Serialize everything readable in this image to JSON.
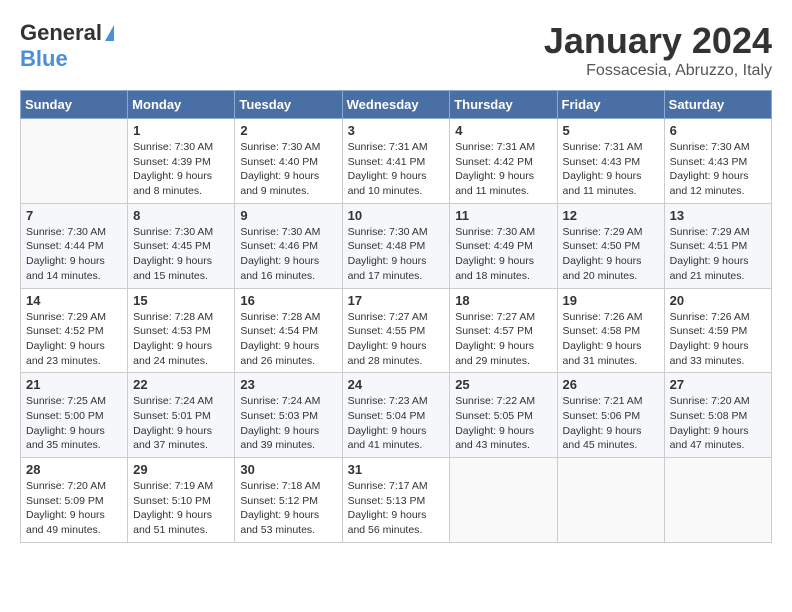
{
  "logo": {
    "general": "General",
    "blue": "Blue"
  },
  "title": "January 2024",
  "location": "Fossacesia, Abruzzo, Italy",
  "weekdays": [
    "Sunday",
    "Monday",
    "Tuesday",
    "Wednesday",
    "Thursday",
    "Friday",
    "Saturday"
  ],
  "weeks": [
    [
      {
        "day": "",
        "info": ""
      },
      {
        "day": "1",
        "info": "Sunrise: 7:30 AM\nSunset: 4:39 PM\nDaylight: 9 hours\nand 8 minutes."
      },
      {
        "day": "2",
        "info": "Sunrise: 7:30 AM\nSunset: 4:40 PM\nDaylight: 9 hours\nand 9 minutes."
      },
      {
        "day": "3",
        "info": "Sunrise: 7:31 AM\nSunset: 4:41 PM\nDaylight: 9 hours\nand 10 minutes."
      },
      {
        "day": "4",
        "info": "Sunrise: 7:31 AM\nSunset: 4:42 PM\nDaylight: 9 hours\nand 11 minutes."
      },
      {
        "day": "5",
        "info": "Sunrise: 7:31 AM\nSunset: 4:43 PM\nDaylight: 9 hours\nand 11 minutes."
      },
      {
        "day": "6",
        "info": "Sunrise: 7:30 AM\nSunset: 4:43 PM\nDaylight: 9 hours\nand 12 minutes."
      }
    ],
    [
      {
        "day": "7",
        "info": "Sunrise: 7:30 AM\nSunset: 4:44 PM\nDaylight: 9 hours\nand 14 minutes."
      },
      {
        "day": "8",
        "info": "Sunrise: 7:30 AM\nSunset: 4:45 PM\nDaylight: 9 hours\nand 15 minutes."
      },
      {
        "day": "9",
        "info": "Sunrise: 7:30 AM\nSunset: 4:46 PM\nDaylight: 9 hours\nand 16 minutes."
      },
      {
        "day": "10",
        "info": "Sunrise: 7:30 AM\nSunset: 4:48 PM\nDaylight: 9 hours\nand 17 minutes."
      },
      {
        "day": "11",
        "info": "Sunrise: 7:30 AM\nSunset: 4:49 PM\nDaylight: 9 hours\nand 18 minutes."
      },
      {
        "day": "12",
        "info": "Sunrise: 7:29 AM\nSunset: 4:50 PM\nDaylight: 9 hours\nand 20 minutes."
      },
      {
        "day": "13",
        "info": "Sunrise: 7:29 AM\nSunset: 4:51 PM\nDaylight: 9 hours\nand 21 minutes."
      }
    ],
    [
      {
        "day": "14",
        "info": "Sunrise: 7:29 AM\nSunset: 4:52 PM\nDaylight: 9 hours\nand 23 minutes."
      },
      {
        "day": "15",
        "info": "Sunrise: 7:28 AM\nSunset: 4:53 PM\nDaylight: 9 hours\nand 24 minutes."
      },
      {
        "day": "16",
        "info": "Sunrise: 7:28 AM\nSunset: 4:54 PM\nDaylight: 9 hours\nand 26 minutes."
      },
      {
        "day": "17",
        "info": "Sunrise: 7:27 AM\nSunset: 4:55 PM\nDaylight: 9 hours\nand 28 minutes."
      },
      {
        "day": "18",
        "info": "Sunrise: 7:27 AM\nSunset: 4:57 PM\nDaylight: 9 hours\nand 29 minutes."
      },
      {
        "day": "19",
        "info": "Sunrise: 7:26 AM\nSunset: 4:58 PM\nDaylight: 9 hours\nand 31 minutes."
      },
      {
        "day": "20",
        "info": "Sunrise: 7:26 AM\nSunset: 4:59 PM\nDaylight: 9 hours\nand 33 minutes."
      }
    ],
    [
      {
        "day": "21",
        "info": "Sunrise: 7:25 AM\nSunset: 5:00 PM\nDaylight: 9 hours\nand 35 minutes."
      },
      {
        "day": "22",
        "info": "Sunrise: 7:24 AM\nSunset: 5:01 PM\nDaylight: 9 hours\nand 37 minutes."
      },
      {
        "day": "23",
        "info": "Sunrise: 7:24 AM\nSunset: 5:03 PM\nDaylight: 9 hours\nand 39 minutes."
      },
      {
        "day": "24",
        "info": "Sunrise: 7:23 AM\nSunset: 5:04 PM\nDaylight: 9 hours\nand 41 minutes."
      },
      {
        "day": "25",
        "info": "Sunrise: 7:22 AM\nSunset: 5:05 PM\nDaylight: 9 hours\nand 43 minutes."
      },
      {
        "day": "26",
        "info": "Sunrise: 7:21 AM\nSunset: 5:06 PM\nDaylight: 9 hours\nand 45 minutes."
      },
      {
        "day": "27",
        "info": "Sunrise: 7:20 AM\nSunset: 5:08 PM\nDaylight: 9 hours\nand 47 minutes."
      }
    ],
    [
      {
        "day": "28",
        "info": "Sunrise: 7:20 AM\nSunset: 5:09 PM\nDaylight: 9 hours\nand 49 minutes."
      },
      {
        "day": "29",
        "info": "Sunrise: 7:19 AM\nSunset: 5:10 PM\nDaylight: 9 hours\nand 51 minutes."
      },
      {
        "day": "30",
        "info": "Sunrise: 7:18 AM\nSunset: 5:12 PM\nDaylight: 9 hours\nand 53 minutes."
      },
      {
        "day": "31",
        "info": "Sunrise: 7:17 AM\nSunset: 5:13 PM\nDaylight: 9 hours\nand 56 minutes."
      },
      {
        "day": "",
        "info": ""
      },
      {
        "day": "",
        "info": ""
      },
      {
        "day": "",
        "info": ""
      }
    ]
  ]
}
